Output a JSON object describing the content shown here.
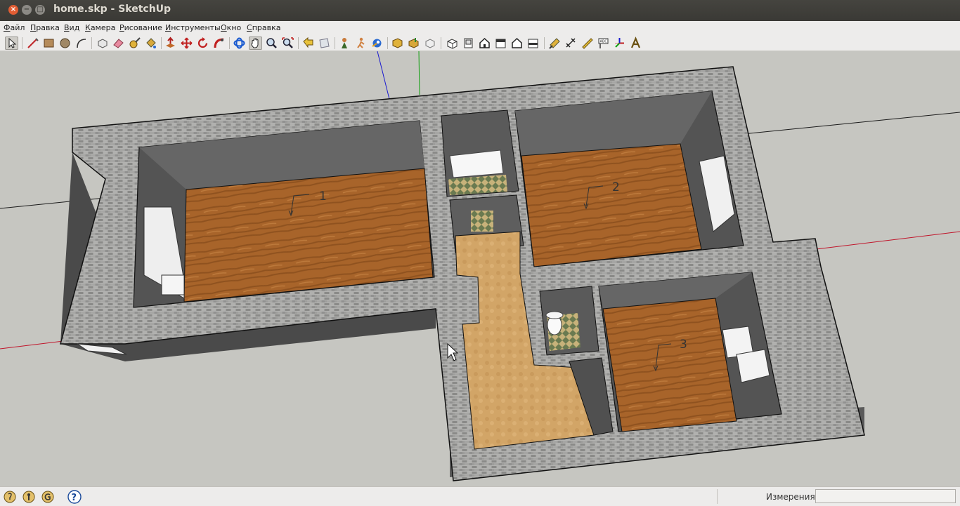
{
  "window": {
    "title": "home.skp - SketchUp"
  },
  "menu": [
    {
      "label": "Файл"
    },
    {
      "label": "Правка"
    },
    {
      "label": "Вид"
    },
    {
      "label": "Камера"
    },
    {
      "label": "Рисование"
    },
    {
      "label": "Инструменты"
    },
    {
      "label": "Окно"
    },
    {
      "label": "Справка"
    }
  ],
  "toolbar_icons": [
    "select-icon",
    "line-icon",
    "rectangle-icon",
    "circle-icon",
    "arc-icon",
    "make-component-icon",
    "eraser-icon",
    "tape-measure-icon",
    "paint-bucket-icon",
    "push-pull-icon",
    "move-icon",
    "rotate-icon",
    "follow-me-icon",
    "orbit-icon",
    "pan-icon",
    "zoom-icon",
    "zoom-extents-icon",
    "previous-view-icon",
    "next-view-icon",
    "position-camera-icon",
    "walk-icon",
    "look-around-icon",
    "get-models-icon",
    "share-model-icon",
    "share-component-icon",
    "iso-view-icon",
    "top-view-icon",
    "front-view-icon",
    "right-view-icon",
    "back-view-icon",
    "left-view-icon",
    "section-plane-icon",
    "dimension-icon",
    "protractor-icon",
    "text-icon",
    "axes-icon",
    "3d-text-icon"
  ],
  "active_tool": "pan-icon",
  "model": {
    "room_labels": [
      "1",
      "2",
      "3"
    ],
    "colors": {
      "floor_wood": "#a8642a",
      "floor_tile": "#d2a567",
      "wall_brick": "#9a9a98",
      "wall_inner": "#555555",
      "background": "#c6c6c1",
      "axis_red": "#c0142a",
      "axis_green": "#14a014",
      "axis_blue": "#1a1ad0"
    }
  },
  "status": {
    "instructor_icons": [
      "lightbulb-icon",
      "user-icon",
      "georeference-icon",
      "help-icon"
    ],
    "measurements_label": "Измерения",
    "measurements_value": ""
  }
}
